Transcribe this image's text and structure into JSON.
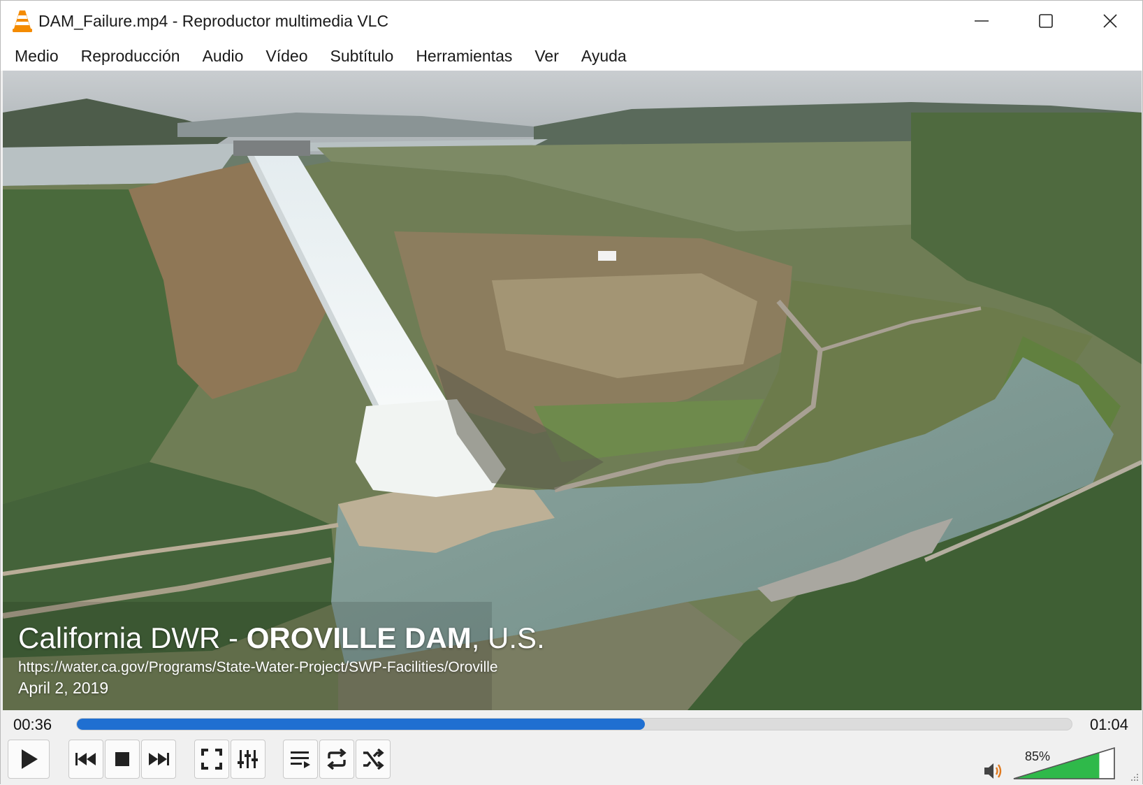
{
  "window": {
    "title": "DAM_Failure.mp4 - Reproductor multimedia VLC",
    "icon": "vlc-cone-icon",
    "controls": [
      "minimize-icon",
      "maximize-icon",
      "close-icon"
    ]
  },
  "menubar": {
    "items": [
      {
        "label": "Medio"
      },
      {
        "label": "Reproducción"
      },
      {
        "label": "Audio"
      },
      {
        "label": "Vídeo"
      },
      {
        "label": "Subtítulo"
      },
      {
        "label": "Herramientas"
      },
      {
        "label": "Ver"
      },
      {
        "label": "Ayuda"
      }
    ]
  },
  "video": {
    "overlay": {
      "title_regular": "California DWR - ",
      "title_bold": "OROVILLE DAM",
      "title_suffix": ", U.S.",
      "url": "https://water.ca.gov/Programs/State-Water-Project/SWP-Facilities/Oroville",
      "date": "April 2, 2019"
    }
  },
  "playback": {
    "elapsed": "00:36",
    "total": "01:04",
    "progress_fraction": 0.5706,
    "seek_color": "#1f6fd1"
  },
  "controls": {
    "buttons": [
      "play-icon",
      "previous-icon",
      "stop-icon",
      "next-icon",
      "fullscreen-icon",
      "extended-settings-icon",
      "playlist-icon",
      "loop-icon",
      "shuffle-icon"
    ]
  },
  "volume": {
    "label": "85%",
    "level_fraction": 0.85,
    "fill_color": "#2fb94a",
    "icon": "speaker-icon"
  }
}
